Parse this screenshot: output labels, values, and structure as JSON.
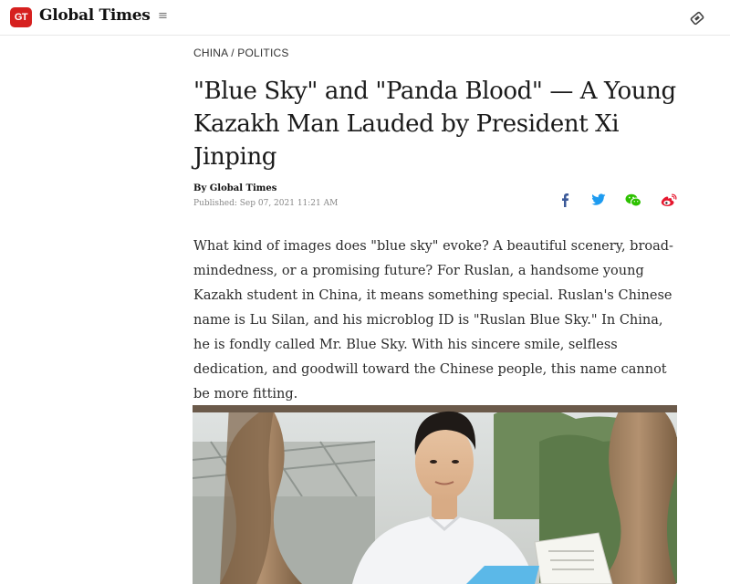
{
  "header": {
    "logo_badge": "GT",
    "brand": "Global Times",
    "menu_icon": "hamburger-menu-icon",
    "right_icon": "ticket-icon"
  },
  "article": {
    "category": "CHINA / POLITICS",
    "title": "\"Blue Sky\" and \"Panda Blood\" — A Young Kazakh Man Lauded by President Xi Jinping",
    "byline": "By Global Times",
    "published": "Published: Sep 07, 2021 11:21 AM",
    "lead": "What kind of images does \"blue sky\" evoke? A beautiful scenery, broad-mindedness, or a promising future? For Ruslan, a handsome young Kazakh student in China, it means something special. Ruslan's Chinese name is Lu Silan, and his microblog ID is \"Ruslan Blue Sky.\" In China, he is fondly called Mr. Blue Sky. With his sincere smile, selfless dedication, and goodwill toward the Chinese people, this name cannot be more fitting."
  },
  "share": {
    "icons": [
      "facebook-icon",
      "twitter-icon",
      "wechat-icon",
      "weibo-icon"
    ],
    "colors": {
      "facebook": "#3b5998",
      "twitter": "#1d9bf0",
      "wechat": "#2dc100",
      "weibo": "#e6162d"
    }
  },
  "colors": {
    "brand_red": "#d6201f",
    "text": "#222222",
    "muted": "#888888"
  }
}
